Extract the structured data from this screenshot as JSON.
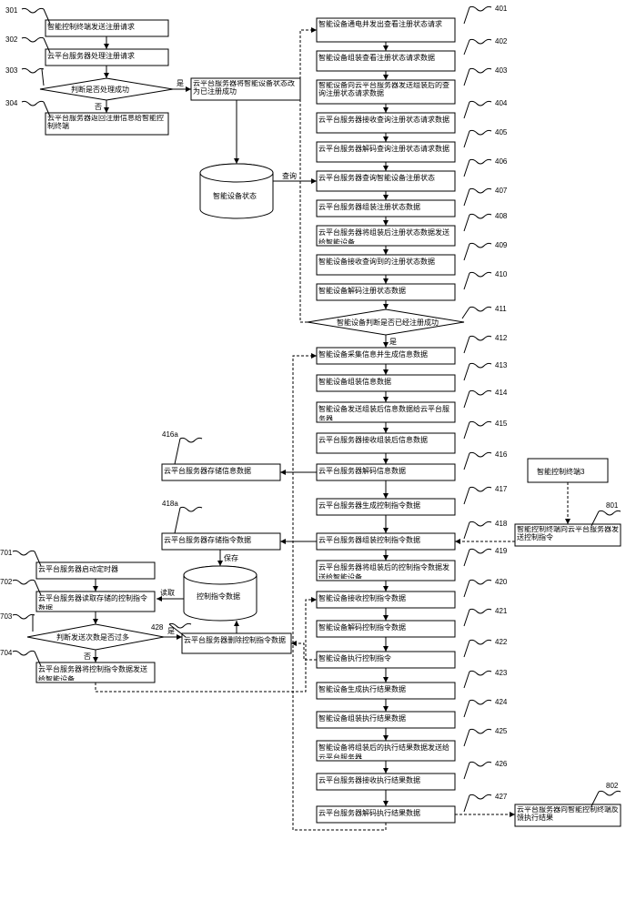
{
  "left": {
    "n301": {
      "num": "301",
      "text": "智能控制终端发送注册请求"
    },
    "n302": {
      "num": "302",
      "text": "云平台服务器处理注册请求"
    },
    "n303": {
      "num": "303",
      "text": "判断是否处理成功"
    },
    "n303b": {
      "text": "云平台服务器将智能设备状态改为已注册成功"
    },
    "n303yes": "是",
    "n303no": "否",
    "n304": {
      "num": "304",
      "text": "云平台服务器返回注册信息给智能控制终端"
    },
    "statecyl": "智能设备状态",
    "query": "查询"
  },
  "mid": {
    "n416a": {
      "num": "416a",
      "text": "云平台服务器存储信息数据"
    },
    "n418a": {
      "num": "418a",
      "text": "云平台服务器存储指令数据"
    },
    "ctrlcyl": "控制指令数据",
    "save": "保存",
    "read": "读取",
    "n428": {
      "num": "428",
      "text": "云平台服务器删除控制指令数据"
    }
  },
  "bottomleft": {
    "n701": {
      "num": "701",
      "text": "云平台服务器启动定时器"
    },
    "n702": {
      "num": "702",
      "text": "云平台服务器读取存储的控制指令数据"
    },
    "n703": {
      "num": "703",
      "text": "判断发送次数是否过多"
    },
    "n703yes": "是",
    "n703no": "否",
    "n704": {
      "num": "704",
      "text": "云平台服务器将控制指令数据发送给智能设备"
    }
  },
  "right": {
    "n401": {
      "num": "401",
      "text": "智能设备通电并发出查看注册状态请求"
    },
    "n402": {
      "num": "402",
      "text": "智能设备组装查看注册状态请求数据"
    },
    "n403": {
      "num": "403",
      "text": "智能设备向云平台服务器发送组装后的查询注册状态请求数据"
    },
    "n404": {
      "num": "404",
      "text": "云平台服务器接收查询注册状态请求数据"
    },
    "n405": {
      "num": "405",
      "text": "云平台服务器解码查询注册状态请求数据"
    },
    "n406": {
      "num": "406",
      "text": "云平台服务器查询智能设备注册状态"
    },
    "n407": {
      "num": "407",
      "text": "云平台服务器组装注册状态数据"
    },
    "n408": {
      "num": "408",
      "text": "云平台服务器将组装后注册状态数据发送给智能设备"
    },
    "n409": {
      "num": "409",
      "text": "智能设备接收查询到的注册状态数据"
    },
    "n410": {
      "num": "410",
      "text": "智能设备解码注册状态数据"
    },
    "n411": {
      "num": "411",
      "text": "智能设备判断是否已经注册成功"
    },
    "n411yes": "是",
    "n412": {
      "num": "412",
      "text": "智能设备采集信息并生成信息数据"
    },
    "n413": {
      "num": "413",
      "text": "智能设备组装信息数据"
    },
    "n414": {
      "num": "414",
      "text": "智能设备发送组装后信息数据给云平台服务器"
    },
    "n415": {
      "num": "415",
      "text": "云平台服务器接收组装后信息数据"
    },
    "n416": {
      "num": "416",
      "text": "云平台服务器解码信息数据"
    },
    "n417": {
      "num": "417",
      "text": "云平台服务器生成控制指令数据"
    },
    "n418": {
      "num": "418",
      "text": "云平台服务器组装控制指令数据"
    },
    "n419": {
      "num": "419",
      "text": "云平台服务器将组装后的控制指令数据发送给智能设备"
    },
    "n420": {
      "num": "420",
      "text": "智能设备接收控制指令数据"
    },
    "n421": {
      "num": "421",
      "text": "智能设备解码控制指令数据"
    },
    "n422": {
      "num": "422",
      "text": "智能设备执行控制指令"
    },
    "n423": {
      "num": "423",
      "text": "智能设备生成执行结果数据"
    },
    "n424": {
      "num": "424",
      "text": "智能设备组装执行结果数据"
    },
    "n425": {
      "num": "425",
      "text": "智能设备将组装后的执行结果数据发送给云平台服务器"
    },
    "n426": {
      "num": "426",
      "text": "云平台服务器接收执行结果数据"
    },
    "n427": {
      "num": "427",
      "text": "云平台服务器解码执行结果数据"
    }
  },
  "far": {
    "term3": "智能控制终端3",
    "n801": {
      "num": "801",
      "text": "智能控制终端向云平台服务器发送控制指令"
    },
    "n802": {
      "num": "802",
      "text": "云平台服务器向智能控制终端反馈执行结果"
    }
  }
}
